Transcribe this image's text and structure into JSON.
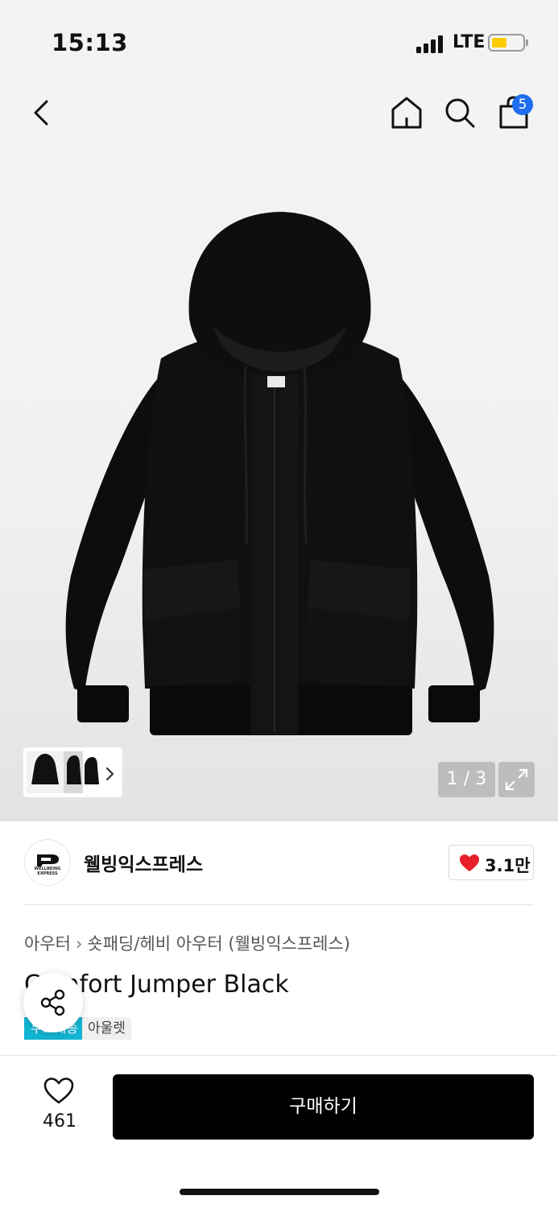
{
  "status_bar": {
    "time": "15:13",
    "network": "LTE",
    "battery_color": "#ffcc00"
  },
  "nav": {
    "back_icon": "chevron-left-icon",
    "home_icon": "home-icon",
    "search_icon": "search-icon",
    "cart_icon": "shopping-bag-icon",
    "cart_badge": "5"
  },
  "gallery": {
    "page_indicator": "1 / 3",
    "zoom_icon": "expand-icon"
  },
  "brand": {
    "name": "웰빙익스프레스",
    "logo_text": "WELLBEING EXPRESS",
    "like_count": "3.1만",
    "heart_color": "#e8202a"
  },
  "breadcrumb": {
    "level1": "아우터",
    "separator": "›",
    "level2": "숏패딩/헤비 아우터 (웰빙익스프레스)"
  },
  "product": {
    "title": "Comfort Jumper Black",
    "tag_free": "무료배송",
    "tag_outlet": "아울렛"
  },
  "bottom_bar": {
    "wish_count": "461",
    "buy_label": "구매하기"
  }
}
